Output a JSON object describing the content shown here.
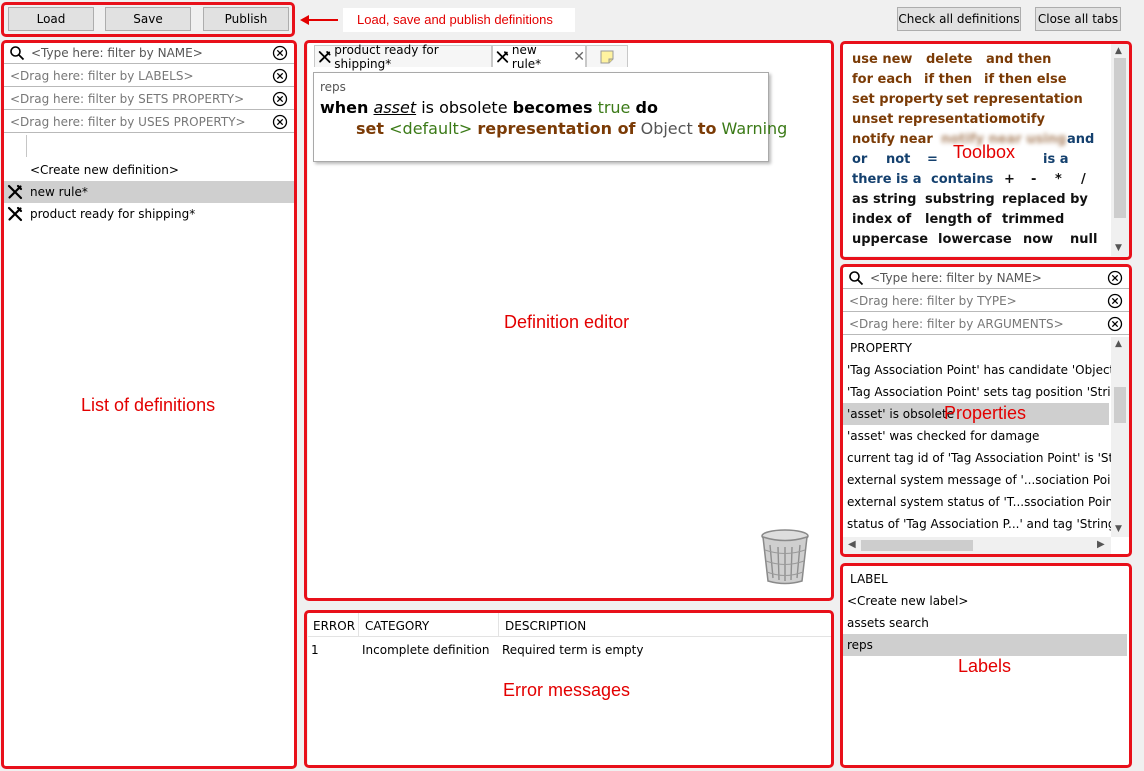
{
  "toolbar": {
    "load_label": "Load",
    "save_label": "Save",
    "publish_label": "Publish",
    "check_all_label": "Check all definitions",
    "close_all_label": "Close all tabs"
  },
  "annotations": {
    "load_save_publish": "Load, save and publish definitions",
    "list_of_definitions": "List of definitions",
    "definition_editor": "Definition editor",
    "error_messages": "Error messages",
    "toolbox": "Toolbox",
    "properties": "Properties",
    "labels": "Labels"
  },
  "definitions": {
    "filters": [
      "<Type here: filter by NAME>",
      "<Drag here: filter by LABELS>",
      "<Drag here: filter by SETS PROPERTY>",
      "<Drag here: filter by USES PROPERTY>"
    ],
    "create_new": "<Create new definition>",
    "items": [
      "new rule*",
      "product ready for shipping*"
    ]
  },
  "editor": {
    "tabs": [
      "product ready for shipping*",
      "new rule*"
    ],
    "rule_label": "reps",
    "line1": {
      "when": "when",
      "subject": "asset",
      "is_obsolete": "is obsolete",
      "becomes": "becomes",
      "true": "true",
      "do": "do"
    },
    "line2": {
      "set": "set",
      "default": "<default>",
      "representation_of": "representation of",
      "object": "Object",
      "to": "to",
      "warning": "Warning"
    }
  },
  "errors": {
    "headers": [
      "ERROR",
      "CATEGORY",
      "DESCRIPTION"
    ],
    "rows": [
      {
        "error": "1",
        "category": "Incomplete definition",
        "description": "Required term is empty"
      }
    ]
  },
  "toolbox": {
    "items": [
      "use new",
      "delete",
      "and then",
      "for each",
      "if then",
      "if then else",
      "set property",
      "set representation",
      "unset representation",
      "notify",
      "notify near",
      "notify near using",
      "and",
      "or",
      "not",
      "=",
      "is a",
      "there is a",
      "contains",
      "+",
      "-",
      "*",
      "/",
      "as string",
      "substring",
      "replaced by",
      "index of",
      "length of",
      "trimmed",
      "uppercase",
      "lowercase",
      "now",
      "null"
    ]
  },
  "properties": {
    "filters": [
      "<Type here: filter by NAME>",
      "<Drag here: filter by TYPE>",
      "<Drag here: filter by ARGUMENTS>"
    ],
    "header": "PROPERTY",
    "items": [
      "'Tag Association Point' has candidate 'Object'",
      "'Tag Association Point' sets tag position 'String'",
      "'asset' is obsolete",
      "'asset' was checked for damage",
      "current tag id of 'Tag Association Point' is 'String'",
      "external system message of '...sociation Point' is 'S",
      "external system status of 'T...ssociation Point' is 'S",
      "status of 'Tag Association P...' and tag 'String' at 'T"
    ]
  },
  "labels": {
    "header": "LABEL",
    "create_new": "<Create new label>",
    "items": [
      "assets search",
      "reps"
    ]
  }
}
